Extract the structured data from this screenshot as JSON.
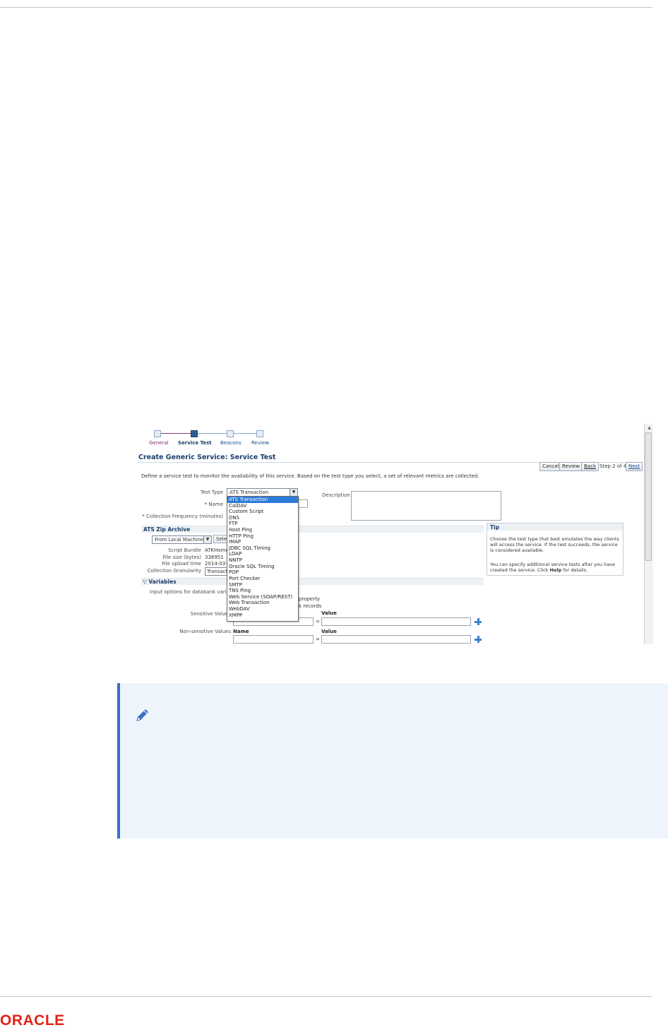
{
  "train": {
    "steps": [
      "General",
      "Service Test",
      "Beacons",
      "Review"
    ],
    "active_index": 1
  },
  "page": {
    "title": "Create Generic Service: Service Test",
    "intro": "Define a service test to monitor the availability of this service. Based on the test type you select, a set of relevant metrics are collected."
  },
  "toolbar": {
    "cancel": "Cancel",
    "review": "Review",
    "back": "Back",
    "step": "Step 2 of 4",
    "next": "Next"
  },
  "form": {
    "test_type_label": "Test Type",
    "test_type_value": "ATS Transaction",
    "name_label": "Name",
    "collection_freq_label": "Collection Frequency (minutes)",
    "description_label": "Description"
  },
  "dropdown_options": [
    "ATS Transaction",
    "CalDAV",
    "Custom Script",
    "DNS",
    "FTP",
    "Host Ping",
    "HTTP Ping",
    "IMAP",
    "JDBC SQL Timing",
    "LDAP",
    "NNTP",
    "Oracle SQL Timing",
    "POP",
    "Port Checker",
    "SMTP",
    "TNS Ping",
    "Web Service (SOAP/REST)",
    "Web Transaction",
    "WebDAV",
    "XMPP"
  ],
  "ats": {
    "section_title": "ATS Zip Archive",
    "source_value": "From Local Machine",
    "select_button": "Select",
    "script_bundle_label": "Script Bundle",
    "script_bundle_value": "ATKHome",
    "file_size_label": "File size (bytes)",
    "file_size_value": "338951",
    "upload_time_label": "File upload time",
    "upload_time_value": "2014-03-",
    "granularity_label": "Collection Granularity",
    "granularity_value": "Transacti"
  },
  "tip": {
    "title": "Tip",
    "line1": "Choose the test type that best emulates the way clients will access the service. If the test succeeds, the service is considered available.",
    "line2_pre": "You can specify additional service tests after you have created the service. Click ",
    "line2_bold": "Help",
    "line2_post": " for details."
  },
  "variables": {
    "section_title": "Variables",
    "input_options_label": "Input options for databank variable",
    "option_a_tail": "property",
    "option_b_tail": "k records",
    "sensitive_label": "Sensitive Value",
    "nonsensitive_label": "Non-sensitive Values",
    "name_header": "Name",
    "value_header": "Value",
    "equals": "="
  }
}
